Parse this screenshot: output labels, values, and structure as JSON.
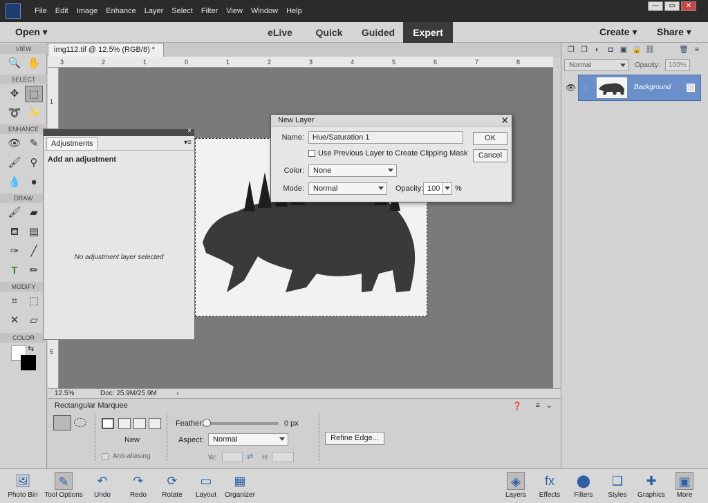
{
  "menu": {
    "items": [
      "File",
      "Edit",
      "Image",
      "Enhance",
      "Layer",
      "Select",
      "Filter",
      "View",
      "Window",
      "Help"
    ]
  },
  "window_controls": {
    "minimize": "—",
    "restore": "▭",
    "close": "✕"
  },
  "modebar": {
    "open": "Open",
    "tabs": [
      "eLive",
      "Quick",
      "Guided",
      "Expert"
    ],
    "active_tab": "Expert",
    "create": "Create",
    "share": "Share"
  },
  "toolbox": {
    "sections": {
      "view": "VIEW",
      "select": "SELECT",
      "enhance": "ENHANCE",
      "draw": "DRAW",
      "modify": "MODIFY",
      "color": "COLOR"
    }
  },
  "document": {
    "tab_label": "img112.tif @ 12.5% (RGB/8) *",
    "tab_close": "×",
    "ruler_top": [
      "3",
      "2",
      "1",
      "0",
      "1",
      "2",
      "3",
      "4",
      "5",
      "6",
      "7",
      "8"
    ],
    "ruler_left": [
      "1",
      "5"
    ],
    "zoom": "12.5%",
    "doc_size": "Doc: 25.9M/25.9M"
  },
  "adjustments": {
    "tab": "Adjustments",
    "heading": "Add an adjustment",
    "empty": "No adjustment layer selected",
    "close": "×"
  },
  "new_layer_dialog": {
    "title": "New Layer",
    "close": "✕",
    "name_label": "Name:",
    "name_value": "Hue/Saturation 1",
    "clipping_label": "Use Previous Layer to Create Clipping Mask",
    "color_label": "Color:",
    "color_value": "None",
    "mode_label": "Mode:",
    "mode_value": "Normal",
    "opacity_label": "Opacity:",
    "opacity_value": "100",
    "opacity_unit": "%",
    "ok": "OK",
    "cancel": "Cancel"
  },
  "layers_panel": {
    "blend_mode": "Normal",
    "opacity_label": "Opacity:",
    "opacity_value": "100%",
    "layer_name": "Background"
  },
  "tool_options": {
    "tool_name": "Rectangular Marquee",
    "selection_mode": "New",
    "anti_alias": "Anti-aliasing",
    "feather_label": "Feather:",
    "feather_value": "0 px",
    "feather_level": 0,
    "aspect_label": "Aspect:",
    "aspect_value": "Normal",
    "w_label": "W:",
    "h_label": "H:",
    "refine_edge": "Refine Edge..."
  },
  "bottombar": {
    "items": [
      "Photo Bin",
      "Tool Options",
      "Undo",
      "Redo",
      "Rotate",
      "Layout",
      "Organizer"
    ],
    "right_items": [
      "Layers",
      "Effects",
      "Filters",
      "Styles",
      "Graphics",
      "More"
    ]
  },
  "colors": {
    "accent_layer": "#6a8fc9",
    "menubar": "#2b2b2b",
    "active_tab": "#3a3a3a"
  }
}
